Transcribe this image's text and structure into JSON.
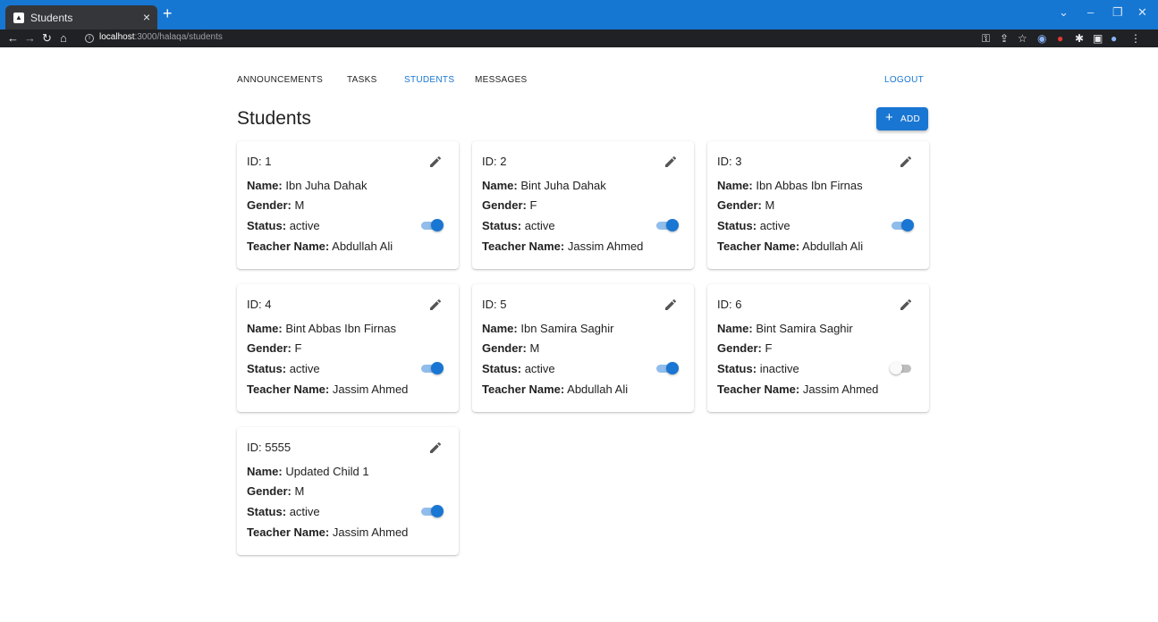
{
  "browser": {
    "tab_title": "Students",
    "url_host": "localhost",
    "url_path": ":3000/halaqa/students"
  },
  "nav": {
    "links": [
      "ANNOUNCEMENTS",
      "TASKS",
      "STUDENTS",
      "MESSAGES"
    ],
    "active": "STUDENTS",
    "logout": "LOGOUT"
  },
  "page": {
    "title": "Students",
    "add_label": "ADD"
  },
  "labels": {
    "name": "Name:",
    "gender": "Gender:",
    "status": "Status:",
    "teacher": "Teacher Name:"
  },
  "students": [
    {
      "id": "ID: 1",
      "name": "Ibn Juha Dahak",
      "gender": "M",
      "status": "active",
      "teacher": "Abdullah Ali",
      "active": true
    },
    {
      "id": "ID: 2",
      "name": "Bint Juha Dahak",
      "gender": "F",
      "status": "active",
      "teacher": "Jassim Ahmed",
      "active": true
    },
    {
      "id": "ID: 3",
      "name": "Ibn Abbas Ibn Firnas",
      "gender": "M",
      "status": "active",
      "teacher": "Abdullah Ali",
      "active": true
    },
    {
      "id": "ID: 4",
      "name": "Bint Abbas Ibn Firnas",
      "gender": "F",
      "status": "active",
      "teacher": "Jassim Ahmed",
      "active": true
    },
    {
      "id": "ID: 5",
      "name": "Ibn Samira Saghir",
      "gender": "M",
      "status": "active",
      "teacher": "Abdullah Ali",
      "active": true
    },
    {
      "id": "ID: 6",
      "name": "Bint Samira Saghir",
      "gender": "F",
      "status": "inactive",
      "teacher": "Jassim Ahmed",
      "active": false
    },
    {
      "id": "ID: 5555",
      "name": "Updated Child 1",
      "gender": "M",
      "status": "active",
      "teacher": "Jassim Ahmed",
      "active": true
    }
  ],
  "colors": {
    "primary": "#1976d2",
    "tabbar": "#1677d2",
    "addressbar": "#202124"
  }
}
